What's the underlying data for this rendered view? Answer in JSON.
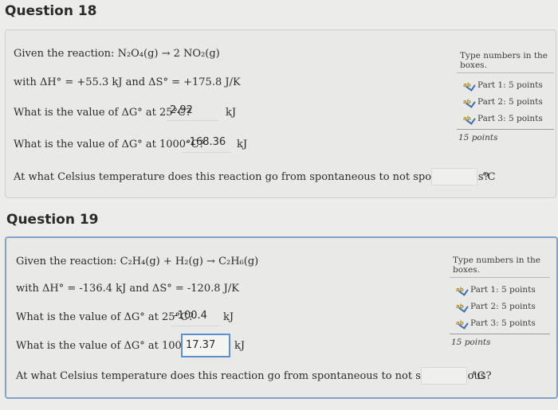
{
  "q18": {
    "header": "Question 18",
    "reaction_label": "Given the reaction:",
    "reaction": "N₂O₄(g) → 2 NO₂(g)",
    "thermo": "with ΔH° = +55.3 kJ and ΔS° = +175.8 J/K",
    "p1_q": "What is the value of ΔG° at 25°C?",
    "p1_ans": "2.92",
    "p1_unit": "kJ",
    "p2_q": "What is the value of ΔG° at 1000°C?",
    "p2_ans": "-168.36",
    "p2_unit": "kJ",
    "p3_q": "At what Celsius temperature does this reaction go from spontaneous to not spontanteous?",
    "p3_unit": "°C",
    "side": {
      "title": "Type numbers in the boxes.",
      "parts": [
        "Part 1: 5 points",
        "Part 2: 5 points",
        "Part 3: 5 points"
      ],
      "total": "15 points"
    }
  },
  "q19": {
    "header": "Question 19",
    "reaction_label": "Given the reaction:",
    "reaction": "C₂H₄(g) + H₂(g) → C₂H₆(g)",
    "thermo": "with ΔH° = -136.4 kJ and ΔS° = -120.8 J/K",
    "p1_q": "What is the value of ΔG° at 25°C?",
    "p1_ans": "-100.4",
    "p1_unit": "kJ",
    "p2_q": "What is the value of ΔG° at 1000°C?",
    "p2_ans": "17.37",
    "p2_unit": "kJ",
    "p3_q": "At what Celsius temperature does this reaction go from spontaneous to not spontanteous?",
    "p3_unit": "°C",
    "side": {
      "title": "Type numbers in the boxes.",
      "parts": [
        "Part 1: 5 points",
        "Part 2: 5 points",
        "Part 3: 5 points"
      ],
      "total": "15 points"
    }
  }
}
